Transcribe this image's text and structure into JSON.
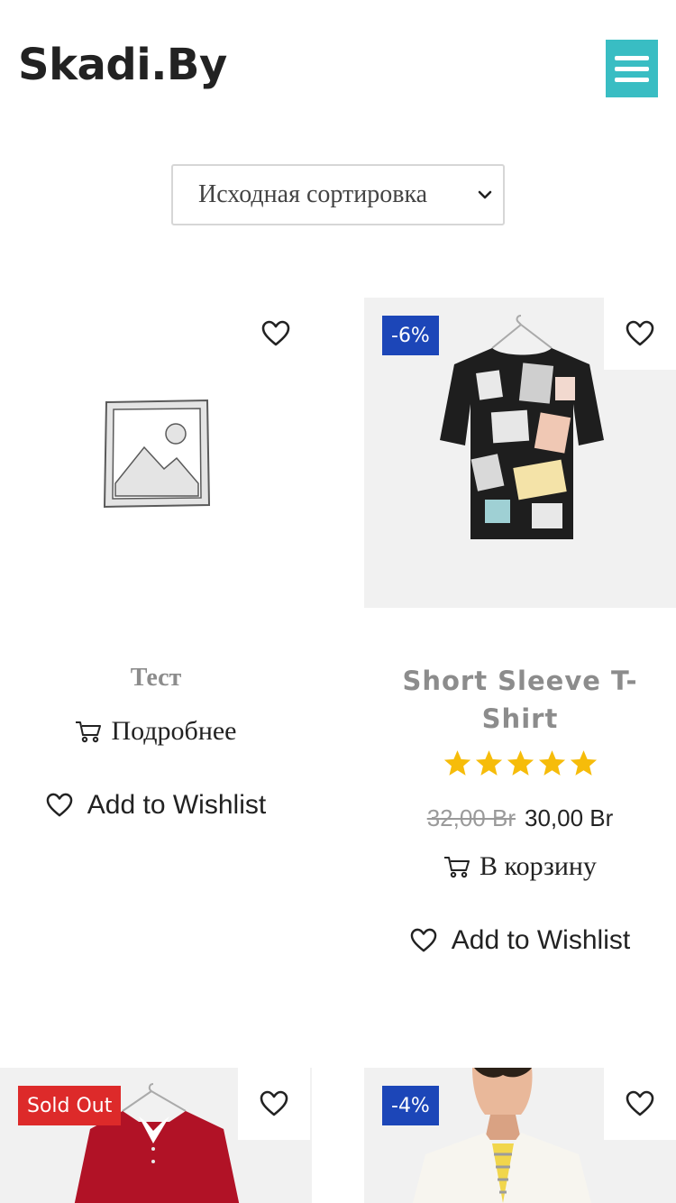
{
  "header": {
    "logo": "Skadi.By",
    "menu_icon": "hamburger-menu-icon",
    "accent_color": "#39bdc3"
  },
  "sort": {
    "selected": "Исходная сортировка"
  },
  "products": [
    {
      "title": "Тест",
      "action_label": "Подробнее",
      "wishlist_label": "Add to Wishlist",
      "image": "placeholder-image-icon"
    },
    {
      "badge": "-6%",
      "title": "Short Sleeve T-Shirt",
      "rating": 5,
      "max_rating": 5,
      "price_old": "32,00 Br",
      "price_new": "30,00 Br",
      "action_label": "В корзину",
      "wishlist_label": "Add to Wishlist",
      "image": "printed-tshirt-image"
    },
    {
      "badge": "Sold Out",
      "image": "red-polo-shirt-image"
    },
    {
      "badge": "-4%",
      "image": "white-shirt-model-image"
    }
  ],
  "colors": {
    "badge_discount": "#1c46b8",
    "badge_sold_out": "#dd2a2a",
    "star": "#f6bc0a"
  }
}
